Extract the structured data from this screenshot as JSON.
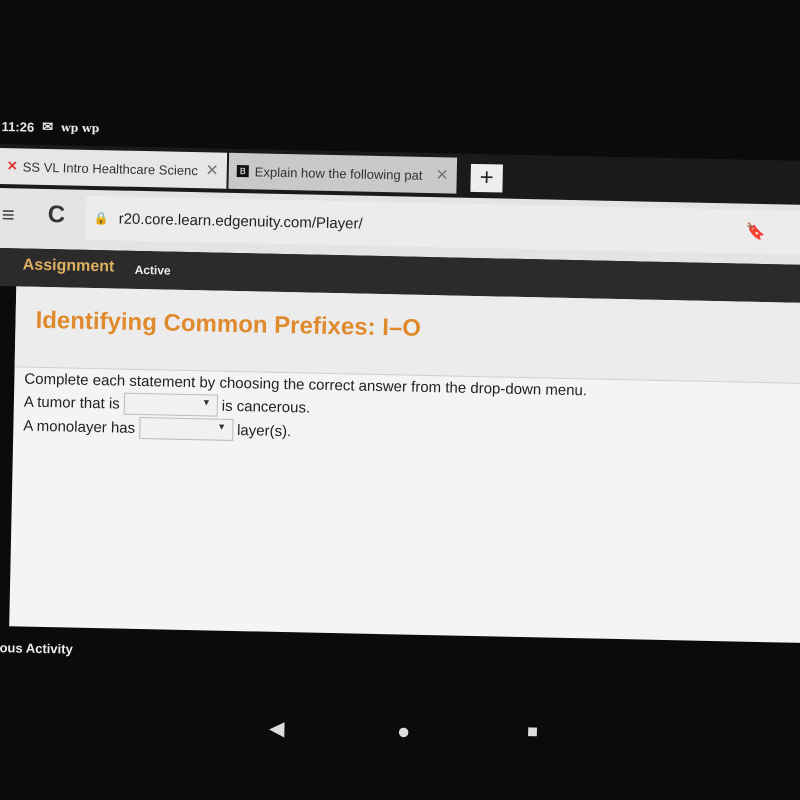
{
  "status": {
    "time": "11:26",
    "icons": [
      "mail-icon",
      "wp-icon",
      "wp-icon"
    ]
  },
  "tabs": [
    {
      "label": "SS VL Intro Healthcare Scienc",
      "icon": "edgenuity-x-icon"
    },
    {
      "label": "Explain how the following pat",
      "icon": "brainly-icon"
    }
  ],
  "address": {
    "url": "r20.core.learn.edgenuity.com/Player/"
  },
  "assignment": {
    "label": "Assignment",
    "status": "Active"
  },
  "activity": {
    "title": "Identifying Common Prefixes: I–O",
    "instructions": "Complete each statement by choosing the correct answer from the drop-down menu.",
    "q1": {
      "before": "A tumor that is",
      "after": "is cancerous.",
      "value": ""
    },
    "q2": {
      "before": "A monolayer has",
      "after": "layer(s).",
      "value": ""
    }
  },
  "footer": {
    "previous": "vious Activity"
  },
  "colors": {
    "title": "#e08a2e",
    "assign_label": "#e0b060"
  }
}
